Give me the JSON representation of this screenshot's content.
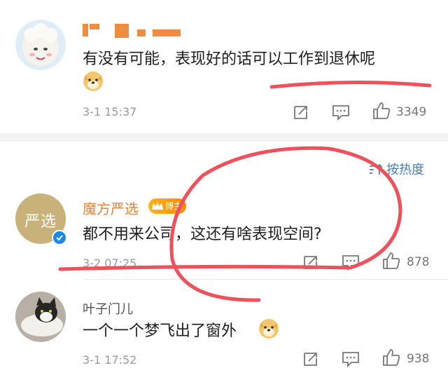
{
  "comments": [
    {
      "username": "",
      "text": "有没有可能，表现好的话可以工作到退休呢",
      "emoji": "doge-emoji",
      "time": "3-1 15:37",
      "likes": "3349"
    },
    {
      "username": "魔方严选",
      "badge": "博主",
      "avatar_text": "严选",
      "text": "都不用来公司，这还有啥表现空间?",
      "time": "3-2 07:25",
      "likes": "878"
    },
    {
      "username": "叶子门儿",
      "text": "一个一个梦飞出了窗外",
      "emoji": "doge-emoji",
      "time": "3-1 17:52",
      "likes": "938"
    }
  ],
  "sort_label": "按热度",
  "colors": {
    "username_orange": "#e8833a",
    "link_blue": "#4a7eb3",
    "scribble_red": "#f0505a",
    "verify_blue": "#1a8ae6"
  }
}
